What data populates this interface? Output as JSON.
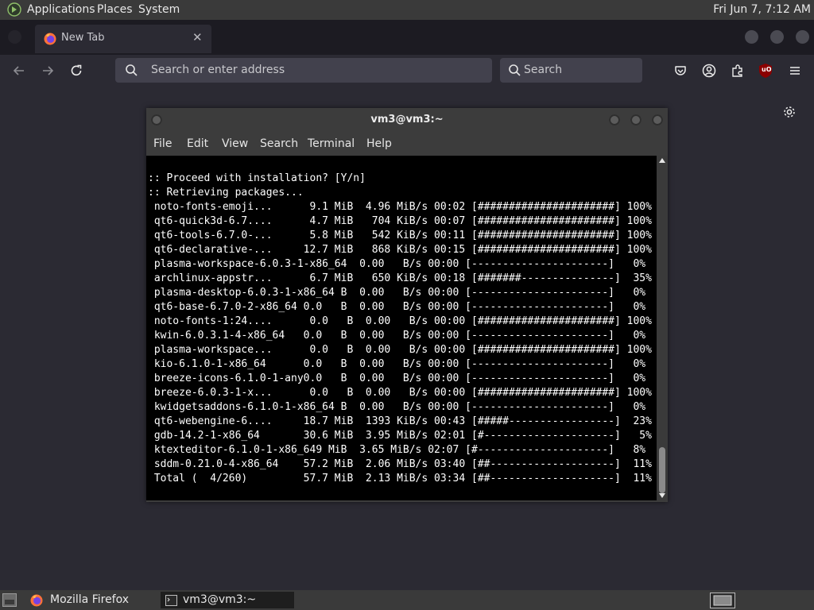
{
  "top_panel": {
    "menus": [
      "Applications",
      "Places",
      "System"
    ],
    "clock": "Fri Jun  7, 7:12 AM"
  },
  "browser": {
    "tab_title": "New Tab",
    "address_placeholder": "Search or enter address",
    "search_placeholder": "Search",
    "addon_badge": "uO"
  },
  "terminal": {
    "title": "vm3@vm3:~",
    "menu": [
      "File",
      "Edit",
      "View",
      "Search",
      "Terminal",
      "Help"
    ],
    "lines": [
      ":: Proceed with installation? [Y/n]",
      ":: Retrieving packages...",
      " noto-fonts-emoji...      9.1 MiB  4.96 MiB/s 00:02 [######################] 100%",
      " qt6-quick3d-6.7....      4.7 MiB   704 KiB/s 00:07 [######################] 100%",
      " qt6-tools-6.7.0-...      5.8 MiB   542 KiB/s 00:11 [######################] 100%",
      " qt6-declarative-...     12.7 MiB   868 KiB/s 00:15 [######################] 100%",
      " plasma-workspace-6.0.3-1-x86_64  0.00   B/s 00:00 [----------------------]   0%",
      " archlinux-appstr...      6.7 MiB   650 KiB/s 00:18 [#######---------------]  35%",
      " plasma-desktop-6.0.3-1-x86_64 B  0.00   B/s 00:00 [----------------------]   0%",
      " qt6-base-6.7.0-2-x86_64 0.0   B  0.00   B/s 00:00 [----------------------]   0%",
      " noto-fonts-1:24....      0.0   B  0.00   B/s 00:00 [######################] 100%",
      " kwin-6.0.3.1-4-x86_64   0.0   B  0.00   B/s 00:00 [----------------------]   0%",
      " plasma-workspace...      0.0   B  0.00   B/s 00:00 [######################] 100%",
      " kio-6.1.0-1-x86_64      0.0   B  0.00   B/s 00:00 [----------------------]   0%",
      " breeze-icons-6.1.0-1-any0.0   B  0.00   B/s 00:00 [----------------------]   0%",
      " breeze-6.0.3-1-x...      0.0   B  0.00   B/s 00:00 [######################] 100%",
      " kwidgetsaddons-6.1.0-1-x86_64 B  0.00   B/s 00:00 [----------------------]   0%",
      " qt6-webengine-6....     18.7 MiB  1393 KiB/s 00:43 [#####-----------------]  23%",
      " gdb-14.2-1-x86_64       30.6 MiB  3.95 MiB/s 02:01 [#---------------------]   5%",
      " ktexteditor-6.1.0-1-x86_649 MiB  3.65 MiB/s 02:07 [#---------------------]   8%",
      " sddm-0.21.0-4-x86_64    57.2 MiB  2.06 MiB/s 03:40 [##--------------------]  11%",
      " Total (  4/260)         57.7 MiB  2.13 MiB/s 03:34 [##--------------------]  11%"
    ]
  },
  "taskbar": {
    "items": [
      "Mozilla Firefox",
      "vm3@vm3:~"
    ]
  },
  "colors": {
    "panel": "#3a3a3a",
    "firefox_bg": "#2b2a33",
    "tabstrip": "#1c1b22",
    "urlbar": "#42414d",
    "terminal_bg": "#000000",
    "addon_red": "#8b0000"
  },
  "icons": [
    "distro-logo-icon",
    "firefox-icon",
    "close-icon",
    "back-icon",
    "forward-icon",
    "reload-icon",
    "search-icon",
    "pocket-icon",
    "account-icon",
    "extensions-icon",
    "ublock-icon",
    "hamburger-menu-icon",
    "gear-icon",
    "show-desktop-icon",
    "terminal-icon",
    "workspace-icon"
  ]
}
